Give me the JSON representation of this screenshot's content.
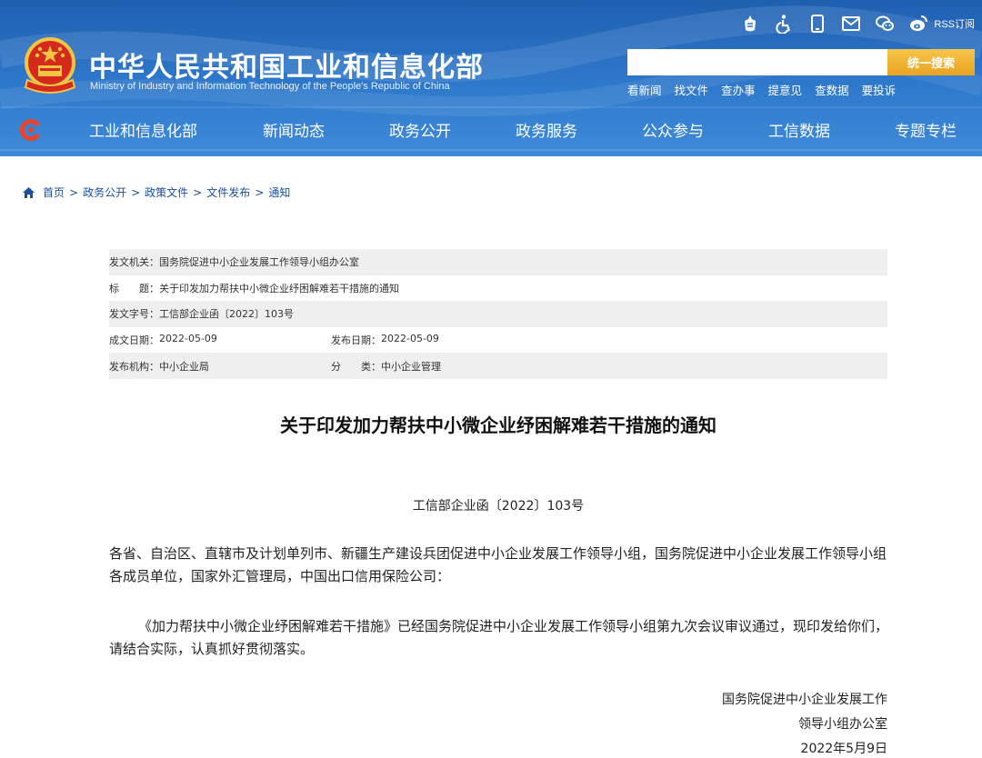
{
  "header": {
    "title": "中华人民共和国工业和信息化部",
    "subtitle": "Ministry of Industry and Information Technology of the People's Republic of China",
    "rss_label": "RSS订阅",
    "search_placeholder": "",
    "search_button": "统一搜索",
    "quick_links": [
      "看新闻",
      "找文件",
      "查办事",
      "提意见",
      "查数据",
      "要投诉"
    ],
    "nav": [
      "工业和信息化部",
      "新闻动态",
      "政务公开",
      "政务服务",
      "公众参与",
      "工信数据",
      "专题专栏"
    ],
    "util_icons": [
      "elder-mode-icon",
      "accessibility-icon",
      "mobile-icon",
      "mail-icon",
      "wechat-icon",
      "weibo-icon"
    ]
  },
  "breadcrumb": [
    "首页",
    "政务公开",
    "政策文件",
    "文件发布",
    "通知"
  ],
  "meta": {
    "issuer_label": "发文机关：",
    "issuer": "国务院促进中小企业发展工作领导小组办公室",
    "title_label": "标　　题：",
    "title": "关于印发加力帮扶中小微企业纾困解难若干措施的通知",
    "doc_no_label": "发文字号：",
    "doc_no": "工信部企业函〔2022〕103号",
    "created_label": "成文日期：",
    "created": "2022-05-09",
    "published_label": "发布日期：",
    "published": "2022-05-09",
    "org_label": "发布机构：",
    "org": "中小企业局",
    "category_label": "分　　类：",
    "category": "中小企业管理"
  },
  "article": {
    "title": "关于印发加力帮扶中小微企业纾困解难若干措施的通知",
    "doc_no": "工信部企业函〔2022〕103号",
    "para1": "各省、自治区、直辖市及计划单列市、新疆生产建设兵团促进中小企业发展工作领导小组，国务院促进中小企业发展工作领导小组各成员单位，国家外汇管理局，中国出口信用保险公司：",
    "para2": "《加力帮扶中小微企业纾困解难若干措施》已经国务院促进中小企业发展工作领导小组第九次会议审议通过，现印发给你们，请结合实际，认真抓好贯彻落实。",
    "sign1": "国务院促进中小企业发展工作",
    "sign2": "领导小组办公室",
    "sign3": "2022年5月9日"
  },
  "colors": {
    "header_blue": "#2f79cc",
    "search_orange": "#eaa321",
    "link_blue": "#1a4f9c",
    "meta_shade": "#efefef"
  }
}
